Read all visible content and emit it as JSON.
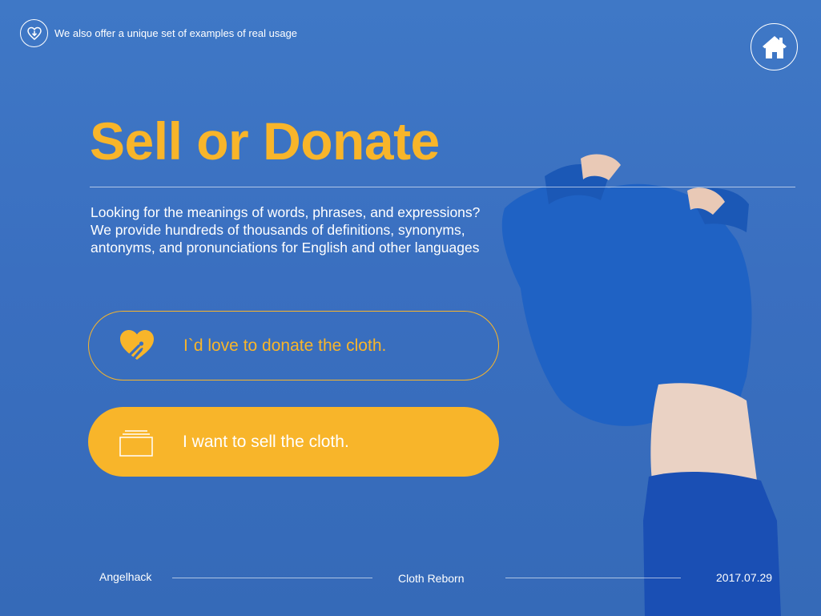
{
  "header": {
    "tagline": "We also offer a unique set of examples of real usage",
    "download_icon": "download-heart-icon",
    "home_icon": "home-icon"
  },
  "main": {
    "title": "Sell or Donate",
    "description_lines": [
      "Looking for the meanings of words, phrases, and expressions?",
      "We provide hundreds of thousands of definitions, synonyms,",
      "antonyms, and pronunciations for English and other languages"
    ]
  },
  "options": {
    "donate": {
      "label": "I`d love to donate the cloth.",
      "icon": "heart-hand-icon"
    },
    "sell": {
      "label": "I want to sell the cloth.",
      "icon": "stack-cards-icon"
    }
  },
  "footer": {
    "left": "Angelhack",
    "center": "Cloth Reborn",
    "right": "2017.07.29"
  },
  "colors": {
    "background": "#3a6fc0",
    "accent": "#f8b52a",
    "text": "#ffffff"
  }
}
